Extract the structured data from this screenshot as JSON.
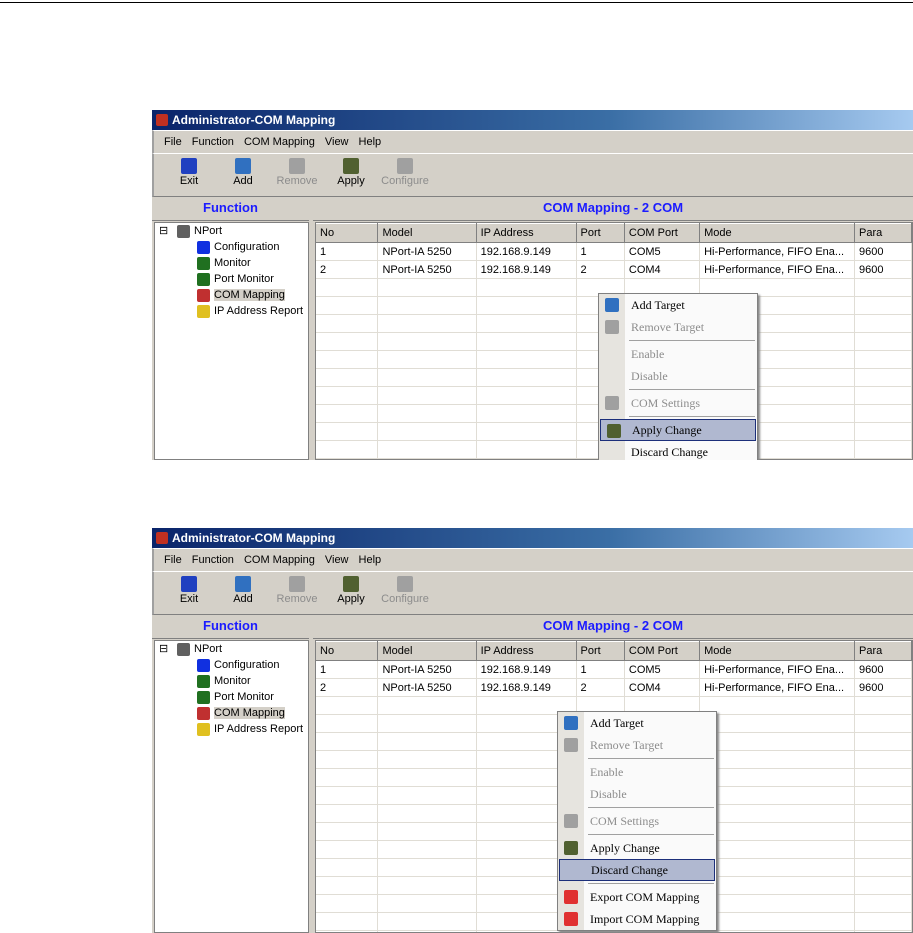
{
  "window": {
    "title": "Administrator-COM Mapping",
    "menu": [
      "File",
      "Function",
      "COM Mapping",
      "View",
      "Help"
    ],
    "toolbar": [
      {
        "label": "Exit",
        "icon": "exit-icon",
        "enabled": true,
        "color": "#2040c0"
      },
      {
        "label": "Add",
        "icon": "add-icon",
        "enabled": true,
        "color": "#3070c0"
      },
      {
        "label": "Remove",
        "icon": "remove-icon",
        "enabled": false,
        "color": "#a0a0a0"
      },
      {
        "label": "Apply",
        "icon": "save-icon",
        "enabled": true,
        "color": "#506030"
      },
      {
        "label": "Configure",
        "icon": "configure-icon",
        "enabled": false,
        "color": "#a0a0a0"
      }
    ],
    "left_header": "Function",
    "tree": [
      {
        "label": "NPort",
        "icon": "nport-icon",
        "color": "#606060",
        "level": 0
      },
      {
        "label": "Configuration",
        "icon": "info-icon",
        "color": "#1030e0",
        "level": 1
      },
      {
        "label": "Monitor",
        "icon": "monitor-icon",
        "color": "#207020",
        "level": 1
      },
      {
        "label": "Port Monitor",
        "icon": "monitor-icon",
        "color": "#207020",
        "level": 1
      },
      {
        "label": "COM Mapping",
        "icon": "com-mapping-icon",
        "color": "#c03030",
        "level": 1,
        "selected": true
      },
      {
        "label": "IP Address Report",
        "icon": "lightbulb-icon",
        "color": "#e0c020",
        "level": 1
      }
    ],
    "right_header": "COM Mapping - 2 COM",
    "columns": [
      "No",
      "Model",
      "IP Address",
      "Port",
      "COM Port",
      "Mode",
      "Para"
    ],
    "rows": [
      [
        "1",
        "NPort-IA 5250",
        "192.168.9.149",
        "1",
        "COM5",
        "Hi-Performance, FIFO Ena...",
        "9600"
      ],
      [
        "2",
        "NPort-IA 5250",
        "192.168.9.149",
        "2",
        "COM4",
        "Hi-Performance, FIFO Ena...",
        "9600"
      ]
    ]
  },
  "screenshots": [
    {
      "highlighted": "Apply Change",
      "menu": [
        "Add Target",
        "Remove Target",
        "-",
        "Enable",
        "Disable",
        "-",
        "COM Settings",
        "-",
        "Apply Change",
        "Discard Change"
      ]
    },
    {
      "highlighted": "Discard Change",
      "menu": [
        "Add Target",
        "Remove Target",
        "-",
        "Enable",
        "Disable",
        "-",
        "COM Settings",
        "-",
        "Apply Change",
        "Discard Change",
        "-",
        "Export COM Mapping",
        "Import COM Mapping"
      ]
    }
  ],
  "menu_items": {
    "Add Target": {
      "enabled": true,
      "icon": "add-target-icon",
      "color": "#3070c0"
    },
    "Remove Target": {
      "enabled": false,
      "icon": "remove-target-icon",
      "color": "#a0a0a0"
    },
    "Enable": {
      "enabled": false
    },
    "Disable": {
      "enabled": false
    },
    "COM Settings": {
      "enabled": false,
      "icon": "com-settings-icon",
      "color": "#a0a0a0"
    },
    "Apply Change": {
      "enabled": true,
      "icon": "save-icon",
      "color": "#506030"
    },
    "Discard Change": {
      "enabled": true
    },
    "Export COM Mapping": {
      "enabled": true,
      "icon": "export-icon",
      "color": "#e03030"
    },
    "Import COM Mapping": {
      "enabled": true,
      "icon": "import-icon",
      "color": "#e03030"
    }
  }
}
